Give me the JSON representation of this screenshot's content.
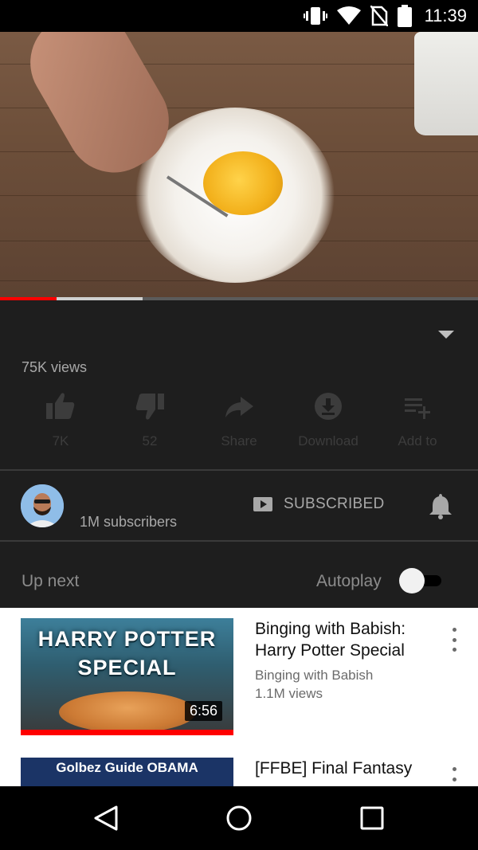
{
  "status_bar": {
    "time": "11:39"
  },
  "player": {
    "progress_played_fraction": 0.118,
    "progress_buffered_fraction": 0.298
  },
  "video_info": {
    "views": "75K views"
  },
  "actions": [
    {
      "name": "like",
      "label": "7K",
      "icon": "thumbs-up-icon"
    },
    {
      "name": "dislike",
      "label": "52",
      "icon": "thumbs-down-icon"
    },
    {
      "name": "share",
      "label": "Share",
      "icon": "share-icon"
    },
    {
      "name": "download",
      "label": "Download",
      "icon": "download-icon"
    },
    {
      "name": "add-to",
      "label": "Add to",
      "icon": "playlist-add-icon"
    }
  ],
  "channel": {
    "subscribers": "1M subscribers",
    "subscribe_label": "SUBSCRIBED"
  },
  "up_next": {
    "label": "Up next",
    "autoplay_label": "Autoplay",
    "autoplay_on": false
  },
  "videos": [
    {
      "thumb_text": "HARRY POTTER SPECIAL",
      "duration": "6:56",
      "title": "Binging with Babish: Harry Potter Special",
      "channel": "Binging with Babish",
      "views": "1.1M views"
    },
    {
      "thumb_text": "Golbez Guide OBAMA",
      "title": "[FFBE] Final Fantasy"
    }
  ],
  "colors": {
    "accent": "#ff0000",
    "background": "#1e1e1e"
  }
}
